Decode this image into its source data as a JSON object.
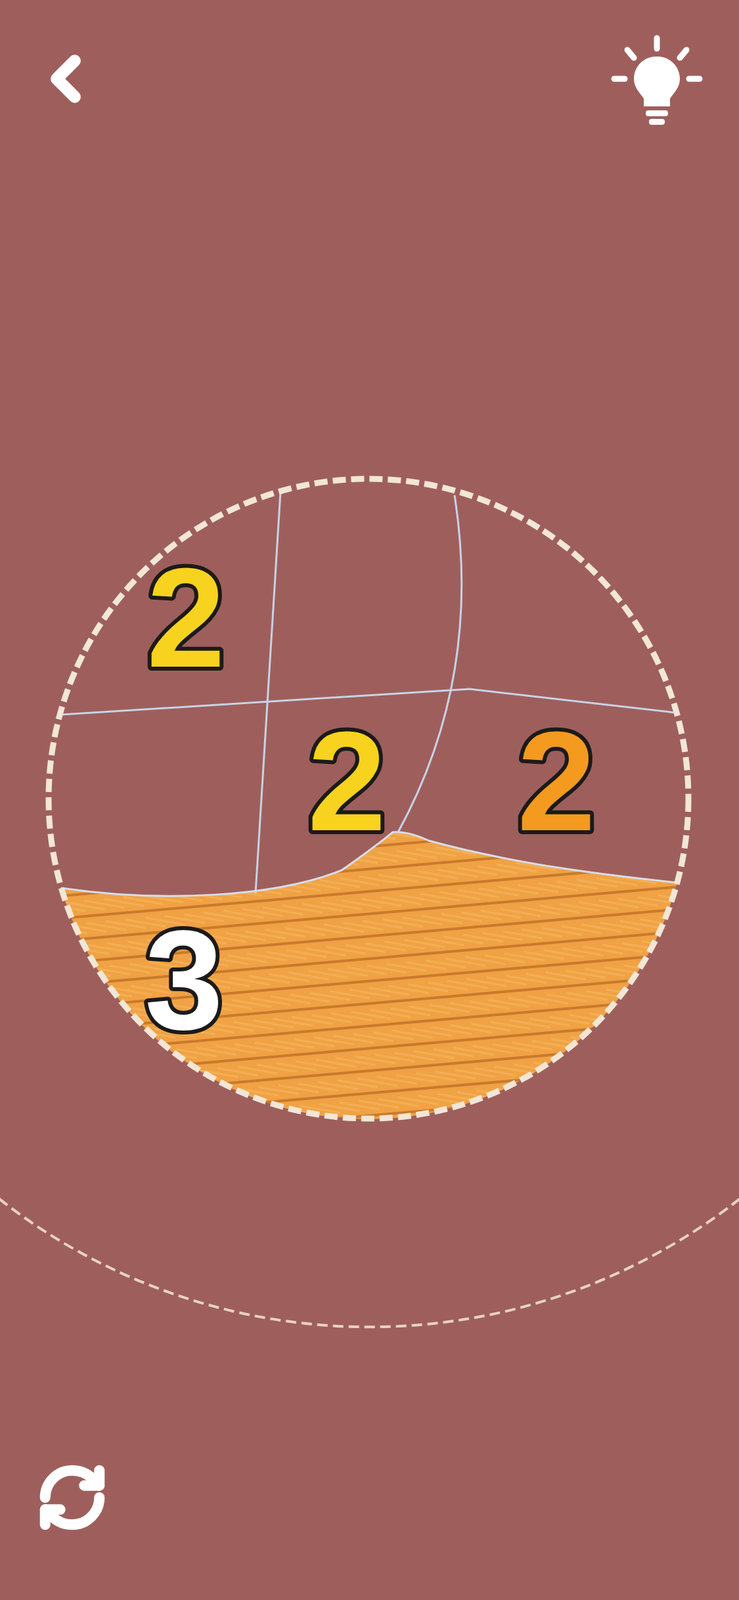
{
  "regions": [
    {
      "label": "2",
      "color": "#f7d21e",
      "filled": false
    },
    {
      "label": "2",
      "color": "#f7d21e",
      "filled": false
    },
    {
      "label": "2",
      "color": "#f39a1f",
      "filled": false
    },
    {
      "label": "3",
      "color": "#ffffff",
      "filled": true
    }
  ]
}
